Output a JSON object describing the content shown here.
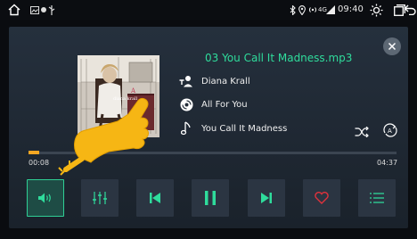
{
  "status_bar": {
    "home_icon": "home-icon",
    "notification_icons": [
      "gallery-icon",
      "usb-icon"
    ],
    "bluetooth_icon": "bluetooth-icon",
    "location_icon": "location-icon",
    "network_label": "4G",
    "signal_icon": "signal-icon",
    "time": "09:40",
    "brightness_icon": "brightness-icon",
    "window_icon": "window-icon",
    "back_icon": "back-icon"
  },
  "player": {
    "title": "03 You Call It Madness.mp3",
    "artist": "Diana Krall",
    "album": "All For You",
    "song": "You Call It Madness",
    "album_art_text": "diana krall",
    "elapsed": "00:08",
    "duration": "04:37",
    "progress": 0.03,
    "close_icon": "close-icon",
    "shuffle_icon": "shuffle-icon",
    "repeat_icon": "repeat-all-icon"
  },
  "controls": [
    {
      "name": "volume-button",
      "icon": "volume-icon",
      "active": true
    },
    {
      "name": "equalizer-button",
      "icon": "equalizer-icon",
      "active": false
    },
    {
      "name": "previous-button",
      "icon": "previous-icon",
      "active": false
    },
    {
      "name": "play-pause-button",
      "icon": "pause-icon",
      "active": false
    },
    {
      "name": "next-button",
      "icon": "next-icon",
      "active": false
    },
    {
      "name": "favorite-button",
      "icon": "heart-icon",
      "active": false
    },
    {
      "name": "playlist-button",
      "icon": "list-icon",
      "active": false
    }
  ],
  "colors": {
    "accent": "#2fdc9c",
    "progress": "#f4a623",
    "favorite": "#e0323c",
    "panel": "#222c38",
    "button": "#2b3542"
  }
}
